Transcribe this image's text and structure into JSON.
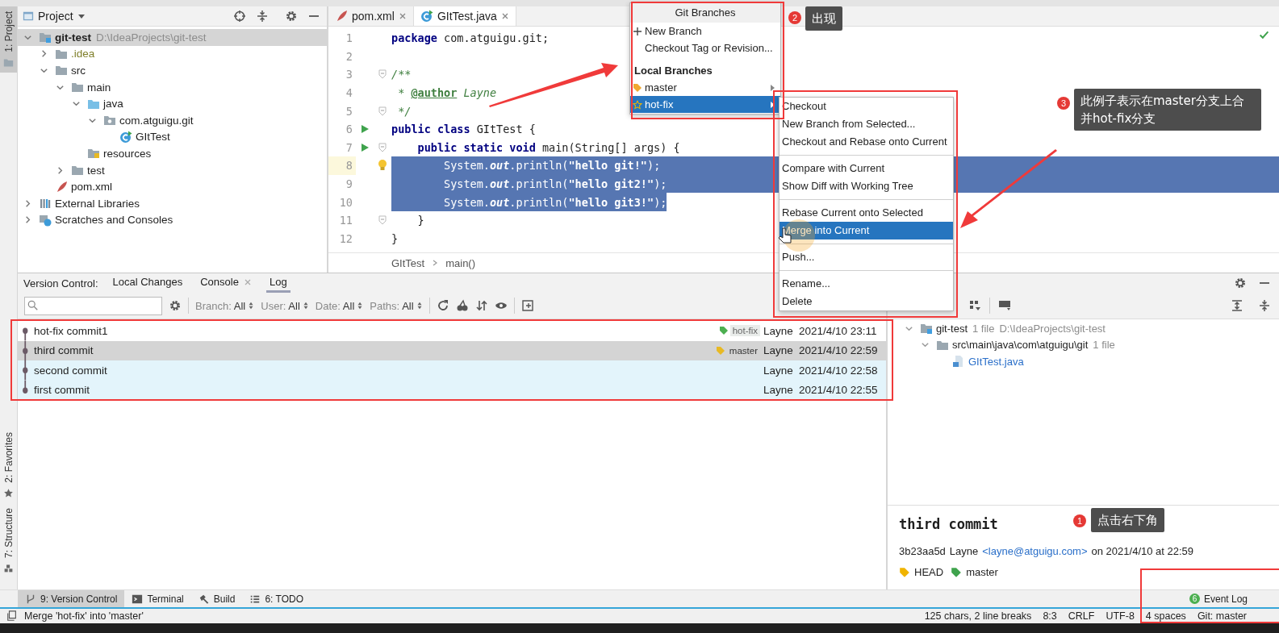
{
  "left_stripe": {
    "top": [
      {
        "label": "1: Project",
        "selected": true
      }
    ],
    "bottom": [
      {
        "label": "2: Favorites",
        "selected": false
      },
      {
        "label": "7: Structure",
        "selected": false
      }
    ]
  },
  "project": {
    "title": "Project",
    "tree": [
      {
        "name": "git-test",
        "note": "D:\\IdeaProjects\\git-test",
        "kind": "module",
        "expanded": true,
        "selected": true,
        "children": [
          {
            "name": ".idea",
            "kind": "excluded",
            "expanded": false,
            "selected": false
          },
          {
            "name": "src",
            "kind": "folder",
            "expanded": true,
            "selected": false,
            "children": [
              {
                "name": "main",
                "kind": "folder",
                "expanded": true,
                "selected": false,
                "children": [
                  {
                    "name": "java",
                    "kind": "source",
                    "expanded": true,
                    "selected": false,
                    "children": [
                      {
                        "name": "com.atguigu.git",
                        "kind": "package",
                        "expanded": true,
                        "selected": false,
                        "children": [
                          {
                            "name": "GItTest",
                            "kind": "class",
                            "selected": false
                          }
                        ]
                      }
                    ]
                  },
                  {
                    "name": "resources",
                    "kind": "resources",
                    "selected": false
                  }
                ]
              },
              {
                "name": "test",
                "kind": "folder",
                "expanded": false,
                "selected": false
              }
            ]
          },
          {
            "name": "pom.xml",
            "kind": "maven",
            "selected": false
          }
        ]
      },
      {
        "name": "External Libraries",
        "kind": "libraries",
        "expanded": false,
        "selected": false
      },
      {
        "name": "Scratches and Consoles",
        "kind": "scratches",
        "expanded": false,
        "selected": false
      }
    ]
  },
  "editor": {
    "tabs": [
      {
        "label": "pom.xml",
        "kind": "maven",
        "selected": false
      },
      {
        "label": "GItTest.java",
        "kind": "class",
        "selected": true
      }
    ],
    "lines": [
      {
        "number": "1",
        "segs": [
          {
            "kind": "kw",
            "t": "package"
          },
          {
            "kind": "p",
            "t": " com.atguigu.git;"
          }
        ],
        "run": false,
        "fold": false,
        "current": false,
        "bulb": false,
        "selected": false
      },
      {
        "number": "2",
        "run": false,
        "fold": false,
        "current": false,
        "bulb": false
      },
      {
        "number": "3",
        "segs": [
          {
            "kind": "doc",
            "t": "/**"
          }
        ],
        "run": false,
        "fold": true,
        "current": false,
        "bulb": false,
        "selected": false
      },
      {
        "number": "4",
        "segs": [
          {
            "kind": "doc",
            "t": " * "
          },
          {
            "kind": "tag",
            "t": "@author"
          },
          {
            "kind": "doc",
            "t": " Layne"
          }
        ],
        "run": false,
        "fold": false,
        "current": false,
        "bulb": false,
        "selected": false
      },
      {
        "number": "5",
        "segs": [
          {
            "kind": "doc",
            "t": " */"
          }
        ],
        "run": false,
        "fold": true,
        "current": false,
        "bulb": false,
        "selected": false
      },
      {
        "number": "6",
        "segs": [
          {
            "kind": "kw",
            "t": "public class"
          },
          {
            "kind": "p",
            "t": " GItTest {"
          }
        ],
        "run": true,
        "fold": false,
        "current": false,
        "bulb": false,
        "selected": false
      },
      {
        "number": "7",
        "segs": [
          {
            "kind": "kw",
            "t": "    public static void"
          },
          {
            "kind": "p",
            "t": " main(String[] args) {"
          }
        ],
        "run": true,
        "fold": true,
        "current": false,
        "bulb": false,
        "selected": false
      },
      {
        "number": "8",
        "segs": [
          {
            "kind": "p",
            "t": "        System."
          },
          {
            "kind": "fld",
            "t": "out"
          },
          {
            "kind": "p",
            "t": ".println("
          },
          {
            "kind": "str",
            "t": "\"hello git!\""
          },
          {
            "kind": "p",
            "t": ");"
          }
        ],
        "run": false,
        "fold": false,
        "current": true,
        "bulb": true,
        "selected": true
      },
      {
        "number": "9",
        "segs": [
          {
            "kind": "p",
            "t": "        System."
          },
          {
            "kind": "fld",
            "t": "out"
          },
          {
            "kind": "p",
            "t": ".println("
          },
          {
            "kind": "str",
            "t": "\"hello git2!\""
          },
          {
            "kind": "p",
            "t": ");"
          }
        ],
        "run": false,
        "fold": false,
        "current": false,
        "bulb": false,
        "selected": true
      },
      {
        "number": "10",
        "segs": [
          {
            "kind": "p",
            "t": "        System."
          },
          {
            "kind": "fld",
            "t": "out"
          },
          {
            "kind": "p",
            "t": ".println("
          },
          {
            "kind": "str",
            "t": "\"hello git3!\""
          },
          {
            "kind": "p",
            "t": ");"
          }
        ],
        "run": false,
        "fold": false,
        "current": false,
        "bulb": false,
        "selected": true
      },
      {
        "number": "11",
        "segs": [
          {
            "kind": "p",
            "t": "    }"
          }
        ],
        "run": false,
        "fold": true,
        "current": false,
        "bulb": false,
        "selected": false
      },
      {
        "number": "12",
        "segs": [
          {
            "kind": "p",
            "t": "}"
          }
        ],
        "run": false,
        "fold": false,
        "current": false,
        "bulb": false,
        "selected": false
      }
    ],
    "breadcrumb": [
      "GItTest",
      "main()"
    ]
  },
  "git_branches": {
    "title": "Git Branches",
    "items": [
      {
        "kind": "create",
        "label": "New Branch",
        "selected": false
      },
      {
        "kind": "action",
        "label": "Checkout Tag or Revision...",
        "selected": false
      },
      {
        "kind": "header",
        "label": "Local Branches"
      },
      {
        "kind": "branch",
        "current": true,
        "label": "master",
        "selected": false
      },
      {
        "kind": "branch",
        "current": false,
        "label": "hot-fix",
        "selected": true
      }
    ]
  },
  "branch_menu": {
    "groups": [
      [
        {
          "label": "Checkout",
          "selected": false
        },
        {
          "label": "New Branch from Selected...",
          "selected": false
        },
        {
          "label": "Checkout and Rebase onto Current",
          "selected": false
        }
      ],
      [
        {
          "label": "Compare with Current",
          "selected": false
        },
        {
          "label": "Show Diff with Working Tree",
          "selected": false
        }
      ],
      [
        {
          "label": "Rebase Current onto Selected",
          "selected": false
        },
        {
          "label": "Merge into Current",
          "selected": true
        }
      ],
      [
        {
          "label": "Push...",
          "selected": false
        }
      ],
      [
        {
          "label": "Rename...",
          "selected": false
        },
        {
          "label": "Delete",
          "selected": false
        }
      ]
    ]
  },
  "version_control": {
    "label": "Version Control:",
    "tabs": [
      {
        "label": "Local Changes",
        "closable": false,
        "selected": false
      },
      {
        "label": "Console",
        "closable": true,
        "selected": false
      },
      {
        "label": "Log",
        "closable": false,
        "selected": true
      }
    ],
    "filters": [
      {
        "label": "Branch:",
        "value": "All"
      },
      {
        "label": "User:",
        "value": "All"
      },
      {
        "label": "Date:",
        "value": "All"
      },
      {
        "label": "Paths:",
        "value": "All"
      }
    ],
    "rows": [
      {
        "message": "hot-fix commit1",
        "ref": {
          "label": "hot-fix",
          "color": "#4caf50"
        },
        "author": "Layne",
        "date": "2021/4/10 23:11",
        "selected": false,
        "highlighted": false
      },
      {
        "message": "third commit",
        "ref": {
          "label": "master",
          "color": "#e8b923"
        },
        "author": "Layne",
        "date": "2021/4/10 22:59",
        "selected": true,
        "highlighted": false
      },
      {
        "message": "second commit",
        "author": "Layne",
        "date": "2021/4/10 22:58",
        "selected": false,
        "highlighted": true
      },
      {
        "message": "first commit",
        "author": "Layne",
        "date": "2021/4/10 22:55",
        "selected": false,
        "highlighted": true
      }
    ],
    "changes": [
      {
        "name": "git-test",
        "count": "1 file",
        "path": "D:\\IdeaProjects\\git-test",
        "kind": "module",
        "expanded": true,
        "children": [
          {
            "name": "src\\main\\java\\com\\atguigu\\git",
            "count": "1 file",
            "kind": "folder",
            "expanded": true,
            "children": [
              {
                "name": "GItTest.java",
                "kind": "file"
              }
            ]
          }
        ]
      }
    ],
    "details": {
      "subject": "third commit",
      "hash": "3b23aa5d",
      "author": "Layne",
      "email": "<layne@atguigu.com>",
      "when": "on 2021/4/10 at 22:59",
      "refs": [
        {
          "label": "HEAD",
          "color": "#f0b400"
        },
        {
          "label": "master",
          "color": "#3fa34d"
        }
      ]
    }
  },
  "tool_tabs": {
    "items": [
      {
        "label": "9: Version Control",
        "selected": true
      },
      {
        "label": "Terminal",
        "selected": false
      },
      {
        "label": "Build",
        "selected": false
      },
      {
        "label": "6: TODO",
        "selected": false
      }
    ],
    "event_log": {
      "label": "Event Log",
      "badge": "6"
    }
  },
  "status_bar": {
    "message": "Merge 'hot-fix' into 'master'",
    "items": [
      "125 chars, 2 line breaks",
      "8:3",
      "CRLF",
      "UTF-8",
      "4 spaces",
      "Git: master"
    ]
  },
  "annotations": {
    "callouts": [
      {
        "number": "2",
        "text": "出现"
      },
      {
        "number": "3",
        "text": "此例子表示在master分支上合并hot-fix分支"
      },
      {
        "number": "1",
        "text": "点击右下角"
      }
    ]
  }
}
